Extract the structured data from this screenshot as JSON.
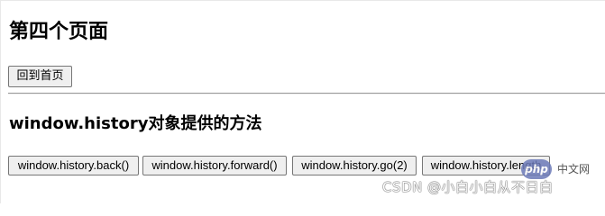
{
  "page": {
    "title": "第四个页面",
    "home_button_label": "回到首页",
    "section_title": "window.history对象提供的方法",
    "history_buttons": [
      {
        "label": "window.history.back()"
      },
      {
        "label": "window.history.forward()"
      },
      {
        "label": "window.history.go(2)"
      },
      {
        "label": "window.history.length"
      }
    ]
  },
  "watermark": {
    "logo_text": "php",
    "site_text": "中文网",
    "author_text": "CSDN @小白小白从不日白"
  }
}
